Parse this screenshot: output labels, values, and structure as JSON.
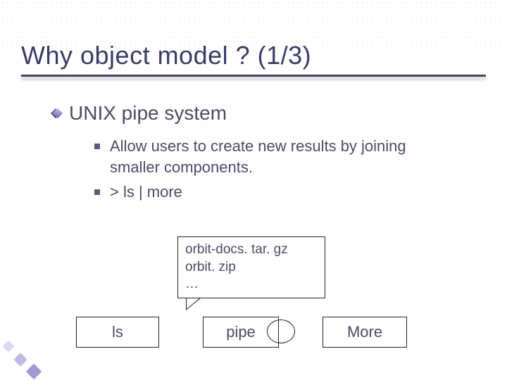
{
  "title": "Why object model ? (1/3)",
  "level1": {
    "text": "UNIX pipe system"
  },
  "level2": [
    {
      "text": "Allow users to create new results by joining smaller components."
    },
    {
      "text": "> ls | more"
    }
  ],
  "callout": {
    "line1": "orbit-docs. tar. gz",
    "line2": "orbit. zip",
    "line3": "…"
  },
  "boxes": {
    "ls": "ls",
    "pipe": "pipe",
    "more": "More"
  }
}
